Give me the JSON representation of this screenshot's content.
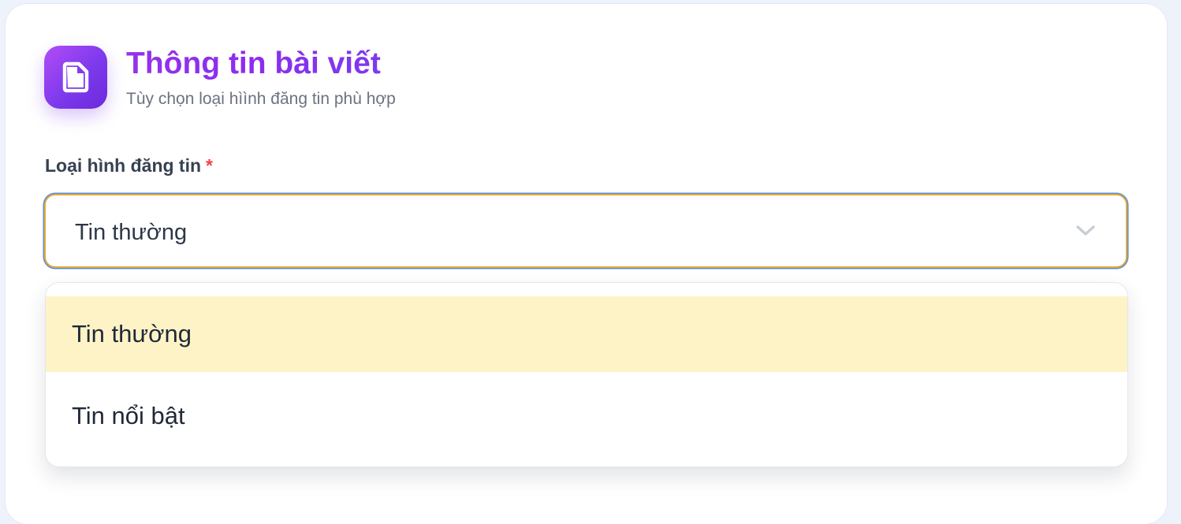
{
  "header": {
    "icon": "document-icon",
    "title": "Thông tin bài viết",
    "subtitle": "Tùy chọn loại hìình đăng tin phù hợp"
  },
  "field": {
    "label": "Loại hình đăng tin",
    "required_mark": "*",
    "selected_value": "Tin thường",
    "chevron_icon": "chevron-down-icon"
  },
  "dropdown": {
    "options": [
      {
        "label": "Tin thường",
        "highlighted": true
      },
      {
        "label": "Tin nổi bật",
        "highlighted": false
      }
    ]
  },
  "colors": {
    "accent_purple": "#8b2cf0",
    "highlight_yellow": "#fef3c7",
    "required_red": "#ef4444",
    "focus_border_orange": "#e5a93c",
    "focus_ring_blue": "#5b8fd6"
  }
}
